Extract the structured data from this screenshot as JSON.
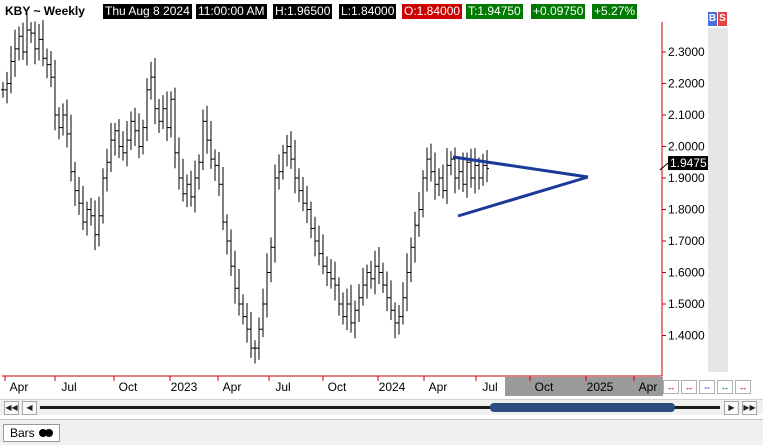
{
  "header": {
    "symbol": "KBY ~ Weekly",
    "date": "Thu Aug 8 2024",
    "time": "11:00:00 AM",
    "high": "H:1.96500",
    "low": "L:1.84000",
    "open": "O:1.84000",
    "last": "T:1.94750",
    "change": "+0.09750",
    "change_pct": "+5.27%"
  },
  "side_panel": {
    "buy_label": "B",
    "sell_label": "S"
  },
  "price_axis": {
    "ticks": [
      "2.3000",
      "2.2000",
      "2.1000",
      "2.0000",
      "1.9000",
      "1.8000",
      "1.7000",
      "1.6000",
      "1.5000",
      "1.4000"
    ],
    "last_price_marker": "1.9475"
  },
  "time_axis": {
    "labels": [
      "Apr",
      "Jul",
      "Oct",
      "2023",
      "Apr",
      "Jul",
      "Oct",
      "2024",
      "Apr",
      "Jul",
      "Oct",
      "2025",
      "Apr"
    ]
  },
  "chart_data": {
    "type": "ohlc_bars",
    "title": "KBY ~ Weekly",
    "ylim": [
      1.3,
      2.42
    ],
    "period": "Weekly",
    "bars_count_estimate": 125,
    "last_close": 1.9475,
    "pattern_lines": [
      {
        "name": "upper trendline",
        "from": {
          "date": "2024-04",
          "price": 1.975
        },
        "to": {
          "date": "2024-11-28",
          "price": 1.92
        }
      },
      {
        "name": "lower trendline",
        "from": {
          "date": "2024-04",
          "price": 1.785
        },
        "to": {
          "date": "2024-11-28",
          "price": 1.912
        }
      }
    ],
    "colors": {
      "bars": "#000000",
      "trendlines": "#1a3a9a",
      "axis_red": "#cc0000"
    }
  },
  "navigator_icons": [
    "zoom-out-icon",
    "zoom-in-icon",
    "fit-icon",
    "scroll-left-icon",
    "scroll-right-icon"
  ],
  "bottom": {
    "tab_label": "Bars"
  }
}
